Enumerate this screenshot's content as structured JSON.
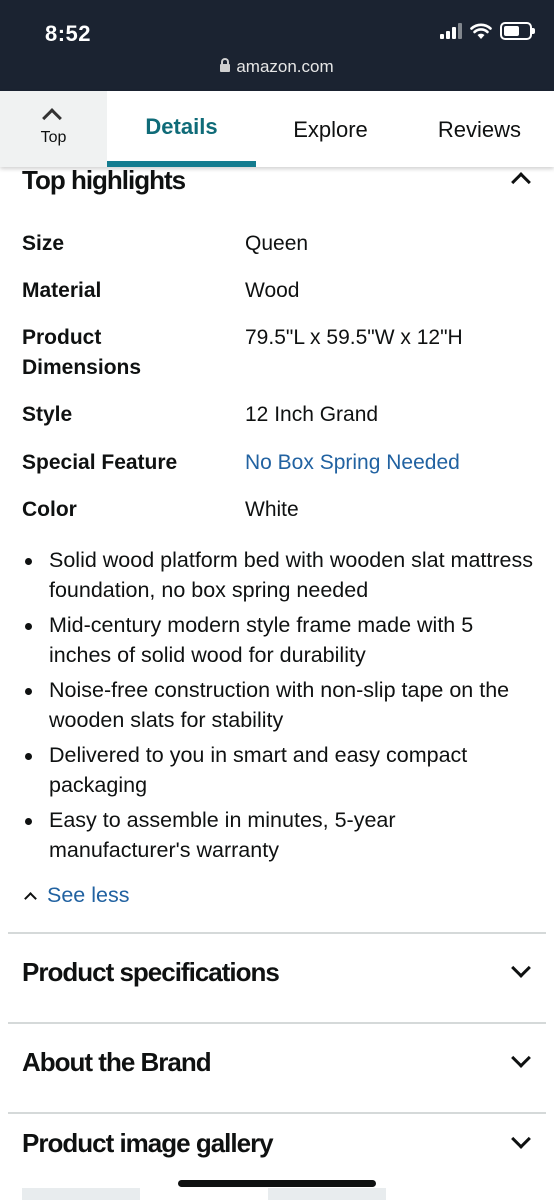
{
  "status_bar": {
    "time": "8:52"
  },
  "url_bar": {
    "domain": "amazon.com"
  },
  "tabs": {
    "top_label": "Top",
    "items": [
      {
        "label": "Details",
        "active": true
      },
      {
        "label": "Explore",
        "active": false
      },
      {
        "label": "Reviews",
        "active": false
      }
    ]
  },
  "top_highlights": {
    "title": "Top highlights",
    "specs": [
      {
        "key": "Size",
        "value": "Queen"
      },
      {
        "key": "Material",
        "value": "Wood"
      },
      {
        "key": "Product Dimensions",
        "value": "79.5\"L x 59.5\"W x 12\"H"
      },
      {
        "key": "Style",
        "value": "12 Inch Grand"
      },
      {
        "key": "Special Feature",
        "value": "No Box Spring Needed"
      },
      {
        "key": "Color",
        "value": "White"
      }
    ],
    "bullets": [
      "Solid wood platform bed with wooden slat mattress foundation, no box spring needed",
      "Mid-century modern style frame made with 5 inches of solid wood for durability",
      "Noise-free construction with non-slip tape on the wooden slats for stability",
      "Delivered to you in smart and easy compact packaging",
      "Easy to assemble in minutes, 5-year manufacturer's warranty"
    ],
    "see_less": "See less"
  },
  "sections": {
    "product_specifications": "Product specifications",
    "about_brand": "About the Brand",
    "image_gallery": "Product image gallery"
  },
  "colors": {
    "accent_teal": "#147c8f",
    "link_blue": "#2162a1",
    "header_dark": "#1b2331"
  }
}
